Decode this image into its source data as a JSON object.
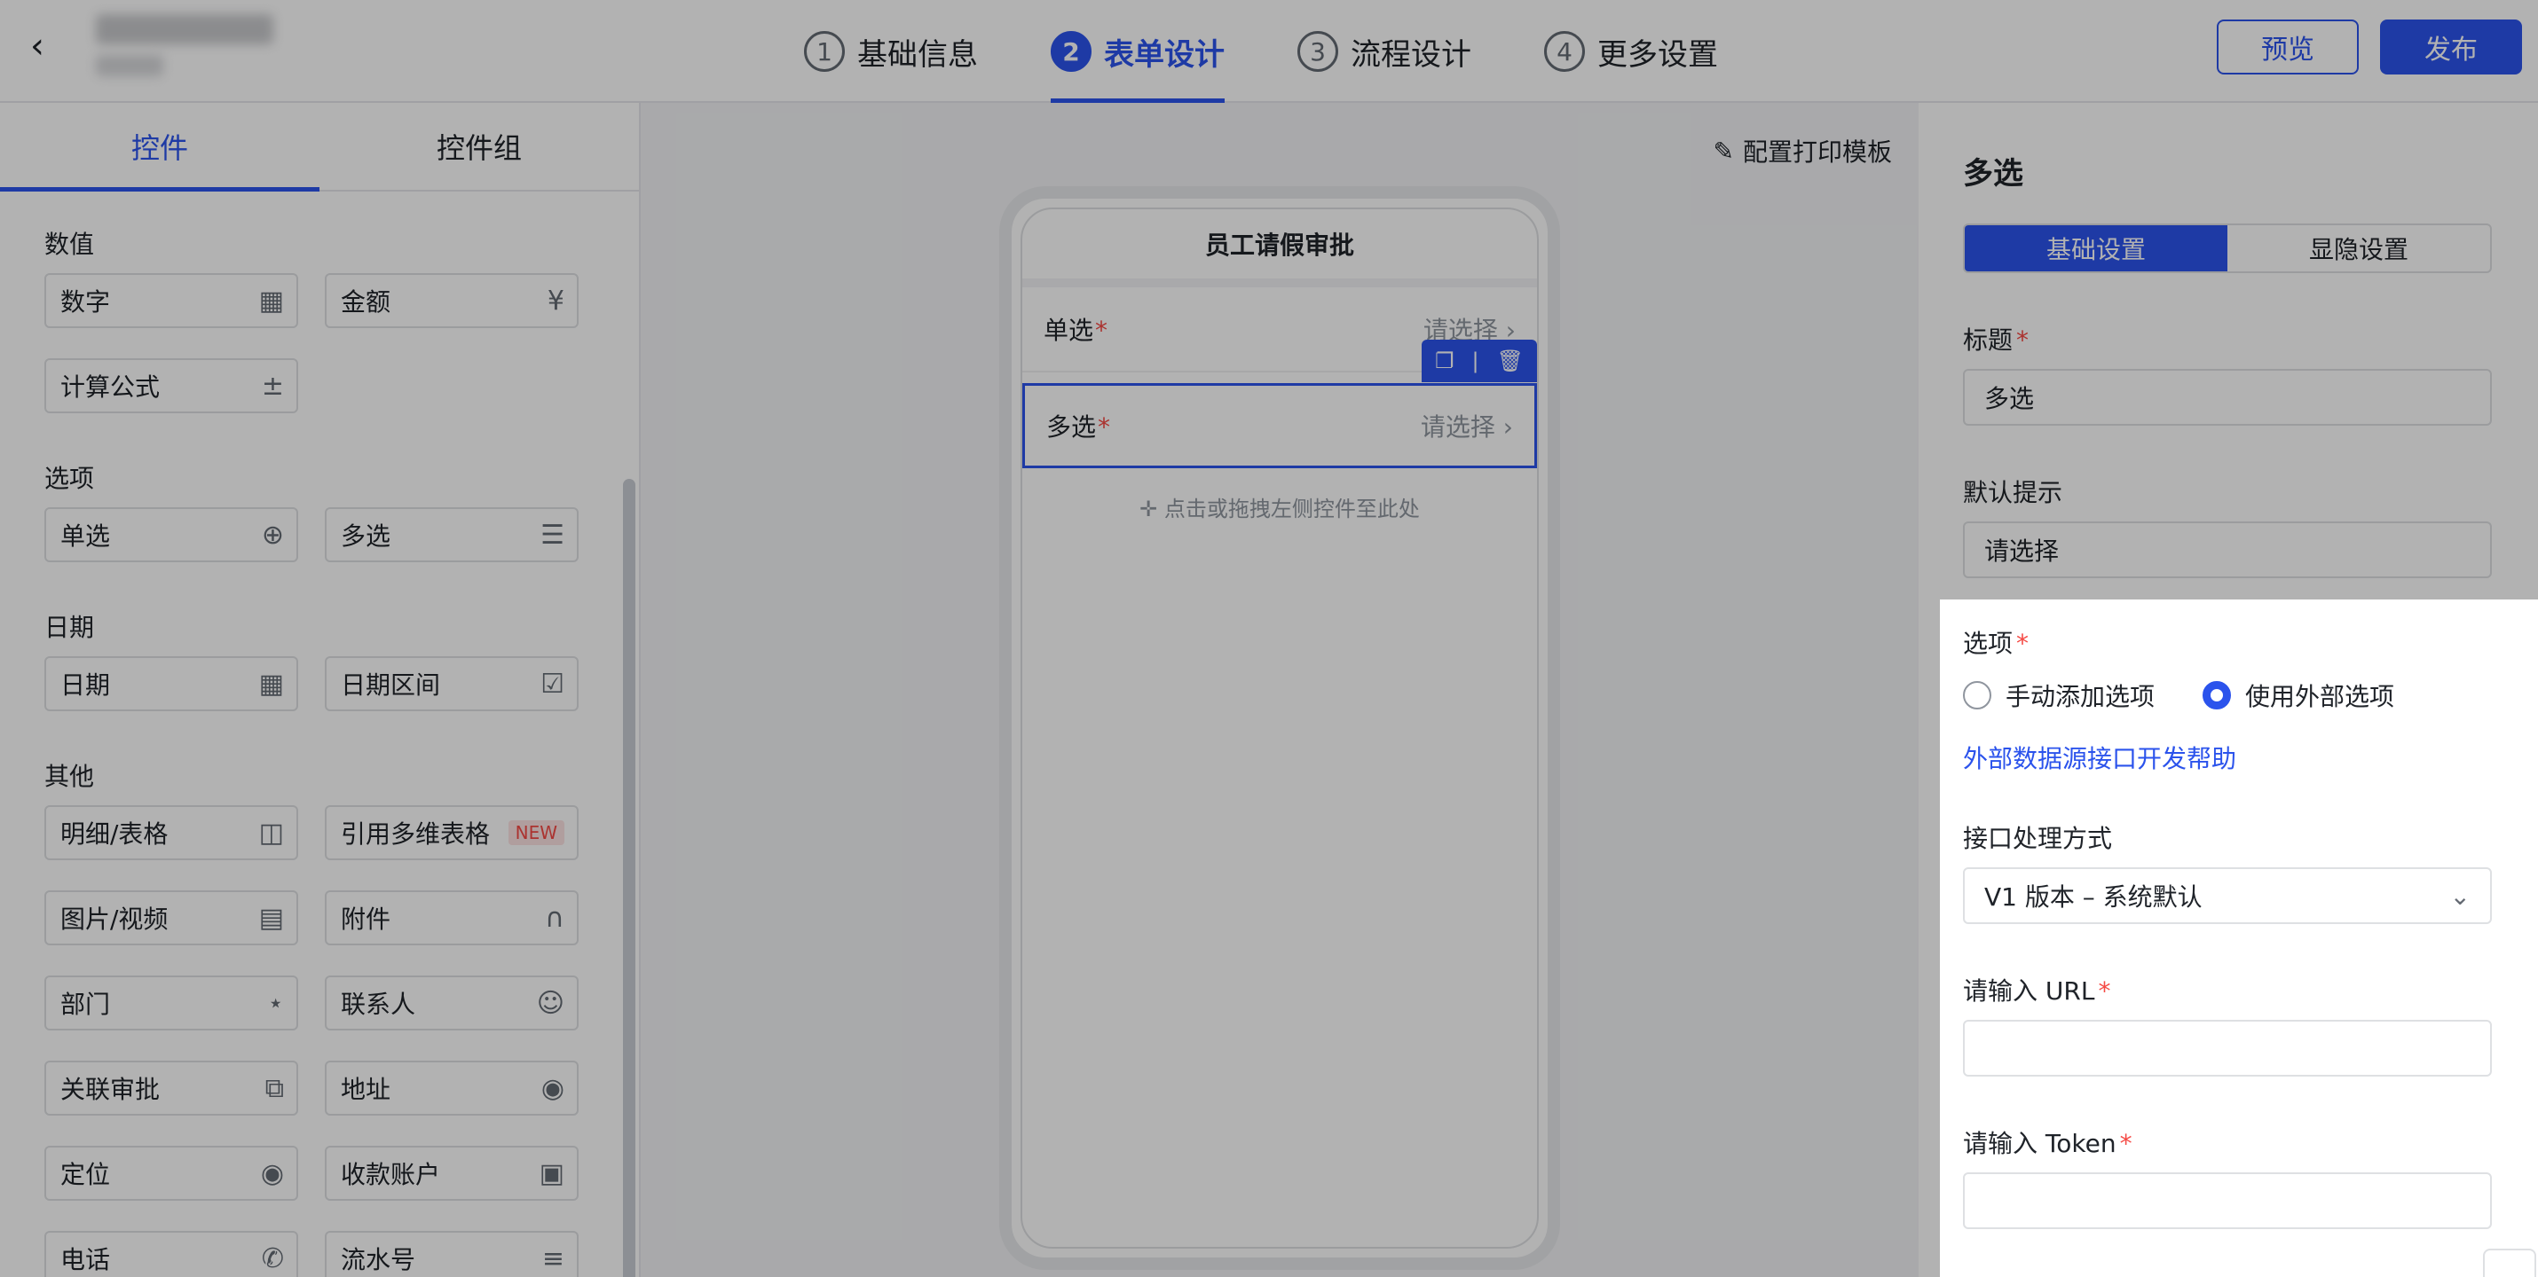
{
  "header": {
    "back_icon": "chevron-left-icon",
    "steps": [
      {
        "num": "1",
        "label": "基础信息"
      },
      {
        "num": "2",
        "label": "表单设计"
      },
      {
        "num": "3",
        "label": "流程设计"
      },
      {
        "num": "4",
        "label": "更多设置"
      }
    ],
    "preview_label": "预览",
    "publish_label": "发布",
    "accent_color": "#2b53ec"
  },
  "left": {
    "tabs": [
      "控件",
      "控件组"
    ],
    "sections": {
      "numeric": "数值",
      "options": "选项",
      "date": "日期",
      "other": "其他"
    },
    "controls": {
      "number": "数字",
      "amount": "金额",
      "formula": "计算公式",
      "single": "单选",
      "multi": "多选",
      "date": "日期",
      "date_range": "日期区间",
      "detail_table": "明细/表格",
      "ref_table": "引用多维表格",
      "new_badge": "NEW",
      "image_video": "图片/视频",
      "attachment": "附件",
      "department": "部门",
      "contact": "联系人",
      "related_approval": "关联审批",
      "address": "地址",
      "location": "定位",
      "payment_account": "收款账户",
      "phone": "电话",
      "serial_number": "流水号"
    }
  },
  "canvas": {
    "print_template": "配置打印模板",
    "form_title": "员工请假审批",
    "fields": [
      {
        "label": "单选",
        "placeholder": "请选择"
      },
      {
        "label": "多选",
        "placeholder": "请选择"
      }
    ],
    "drop_hint": "点击或拖拽左侧控件至此处"
  },
  "right": {
    "title": "多选",
    "seg_tabs": [
      "基础设置",
      "显隐设置"
    ],
    "title_label": "标题",
    "title_value": "多选",
    "default_hint_label": "默认提示",
    "default_hint_value": "请选择",
    "options_label": "选项",
    "radio_manual": "手动添加选项",
    "radio_external": "使用外部选项",
    "help_link": "外部数据源接口开发帮助",
    "api_mode_label": "接口处理方式",
    "api_mode_value": "V1 版本 – 系统默认",
    "url_label": "请输入 URL",
    "url_value": "",
    "token_label": "请输入 Token",
    "token_value": "",
    "required_mark": "*"
  }
}
